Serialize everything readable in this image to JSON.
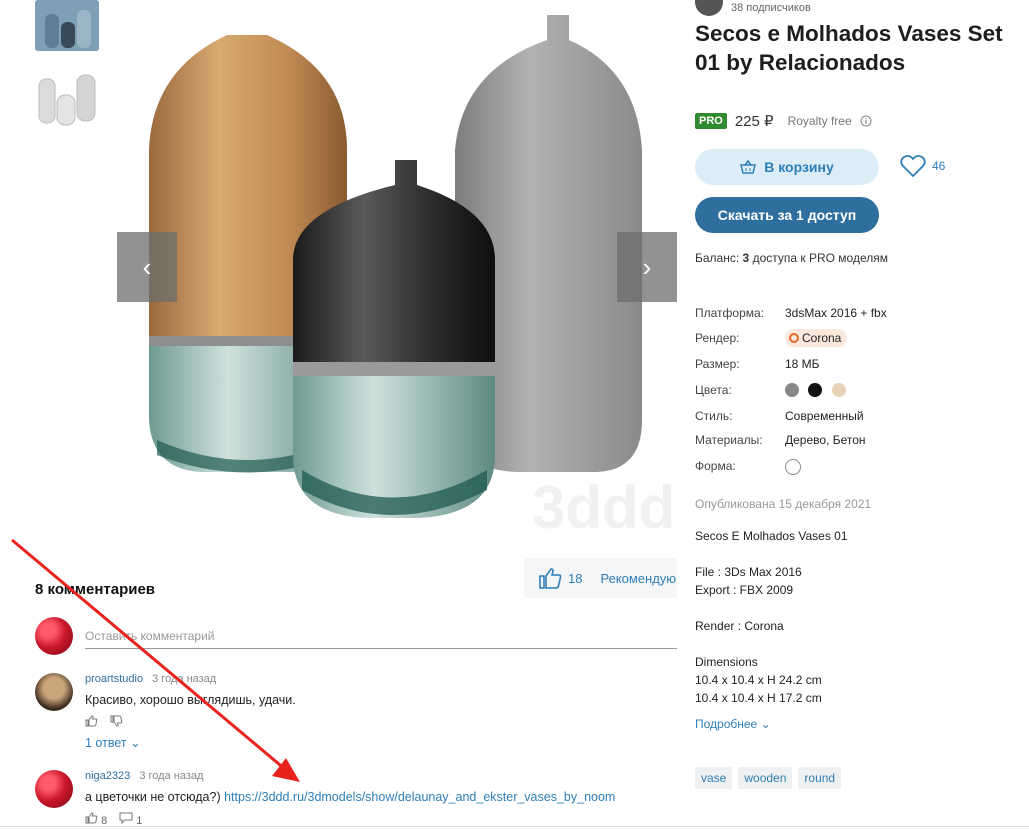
{
  "viewer": {
    "watermark": "3ddd",
    "prev_label": "‹",
    "next_label": "›"
  },
  "recommend": {
    "count": "18",
    "label": "Рекомендую"
  },
  "comments": {
    "title": "8 комментариев",
    "placeholder": "Оставить комментарий",
    "items": [
      {
        "author": "proartstudio",
        "time": "3 года назад",
        "text": "Красиво, хорошо выглядишь, удачи.",
        "likes": "",
        "replies_count": "",
        "reply_link": "1 ответ"
      },
      {
        "author": "niga2323",
        "time": "3 года назад",
        "text": "а цветочки не отсюда?)",
        "link": "https://3ddd.ru/3dmodels/show/delaunay_and_ekster_vases_by_noom",
        "likes": "8",
        "replies_count": "1"
      }
    ]
  },
  "author": {
    "subscribers": "38 подписчиков"
  },
  "product": {
    "title": "Secos e Molhados Vases Set 01 by Relacionados",
    "pro_badge": "PRO",
    "price": "225 ₽",
    "license": "Royalty free",
    "cart_label": "В корзину",
    "favorites": "46",
    "download_label": "Скачать за 1 доступ",
    "balance_prefix": "Баланс:",
    "balance_value": "3",
    "balance_suffix": "доступа к PRO моделям"
  },
  "props": {
    "platform_k": "Платформа:",
    "platform_v": "3dsMax 2016 + fbx",
    "render_k": "Рендер:",
    "render_v": "Corona",
    "size_k": "Размер:",
    "size_v": "18 МБ",
    "colors_k": "Цвета:",
    "colors": [
      "#888888",
      "#111111",
      "#e8d2b8"
    ],
    "style_k": "Стиль:",
    "style_v": "Современный",
    "materials_k": "Материалы:",
    "materials_v": "Дерево, Бетон",
    "shape_k": "Форма:"
  },
  "published": "Опубликована 15 декабря 2021",
  "description": "Secos E Molhados Vases 01\n\nFile : 3Ds Max 2016\nExport : FBX 2009\n\nRender : Corona\n\nDimensions\n10.4 x 10.4 x H 24.2 cm\n10.4 x 10.4 x H 17.2 cm",
  "more_label": "Подробнее",
  "tags": [
    "vase",
    "wooden",
    "round"
  ]
}
